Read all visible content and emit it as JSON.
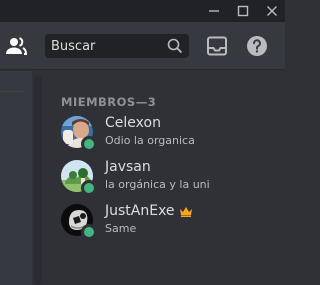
{
  "window": {
    "controls": [
      "minimize-icon",
      "maximize-icon",
      "close-icon"
    ]
  },
  "toolbar": {
    "search": {
      "placeholder": "Buscar",
      "value": ""
    },
    "icons": [
      "members-icon",
      "search-icon",
      "inbox-icon",
      "help-icon"
    ]
  },
  "members": {
    "category": "MIEMBROS—3",
    "list": [
      {
        "name": "Celexon",
        "activity": "Odio la organica",
        "status": "online",
        "status_color": "#43b581"
      },
      {
        "name": "Javsan",
        "activity": "la orgánica y la uni",
        "status": "online",
        "status_color": "#43b581"
      },
      {
        "name": "JustAnExe",
        "activity": "Same",
        "status": "online",
        "status_color": "#43b581",
        "owner": true,
        "badge_icon": "crown-icon",
        "badge_color": "#faa61a"
      }
    ]
  },
  "colors": {
    "background": "#2f3136",
    "titlebar": "#202225",
    "online": "#43b581"
  }
}
